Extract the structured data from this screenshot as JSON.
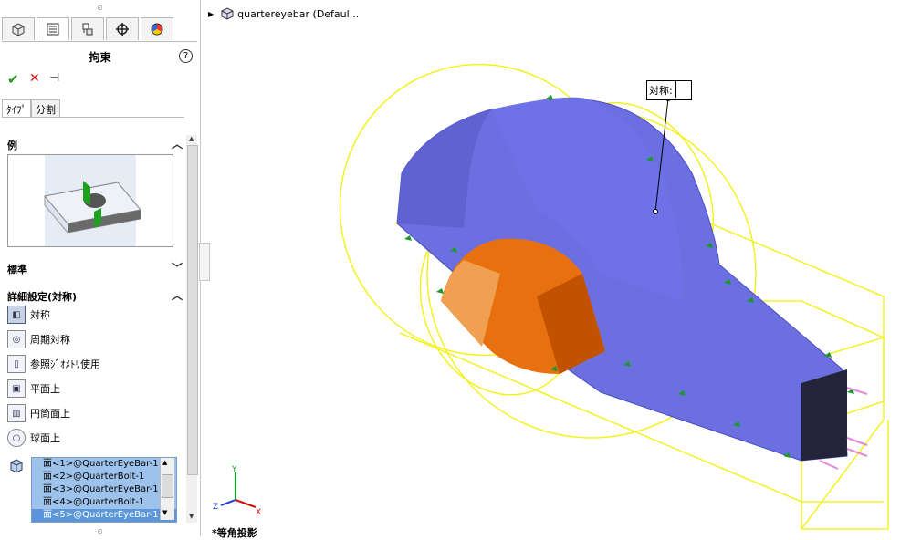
{
  "panel": {
    "title": "拘束",
    "help_symbol": "?",
    "ok_symbol": "✔",
    "cancel_symbol": "✕",
    "pin_symbol": "⊣",
    "grip_symbol": "⊙",
    "tabs": [
      "feature-manager",
      "property-manager",
      "configuration-manager",
      "dim-xpert",
      "display-manager"
    ],
    "subtabs": [
      "ﾀｲﾌﾟ",
      "分割"
    ],
    "sections": {
      "example": "例",
      "standard": "標準",
      "advanced": "詳細設定(対称)"
    },
    "options": [
      "対称",
      "周期対称",
      "参照ｼﾞｵﾒﾄﾘ使用",
      "平面上",
      "円筒面上",
      "球面上"
    ],
    "selections": [
      "面<1>@QuarterEyeBar-1",
      "面<2>@QuarterBolt-1",
      "面<3>@QuarterEyeBar-1",
      "面<4>@QuarterBolt-1",
      "面<5>@QuarterEyeBar-1"
    ]
  },
  "tree": {
    "item": "quartereyebar  (Defaul..."
  },
  "callout": {
    "label": "対称:"
  },
  "view": {
    "label": "*等角投影"
  },
  "triad": {
    "x": "X",
    "y": "Y",
    "z": "Z"
  },
  "colors": {
    "part_blue": "#6b6fe0",
    "bolt_orange": "#e86a10",
    "wire_yellow": "#ffff00",
    "fixture_green": "#1a9a2a",
    "load_pink": "#e08ad8"
  }
}
